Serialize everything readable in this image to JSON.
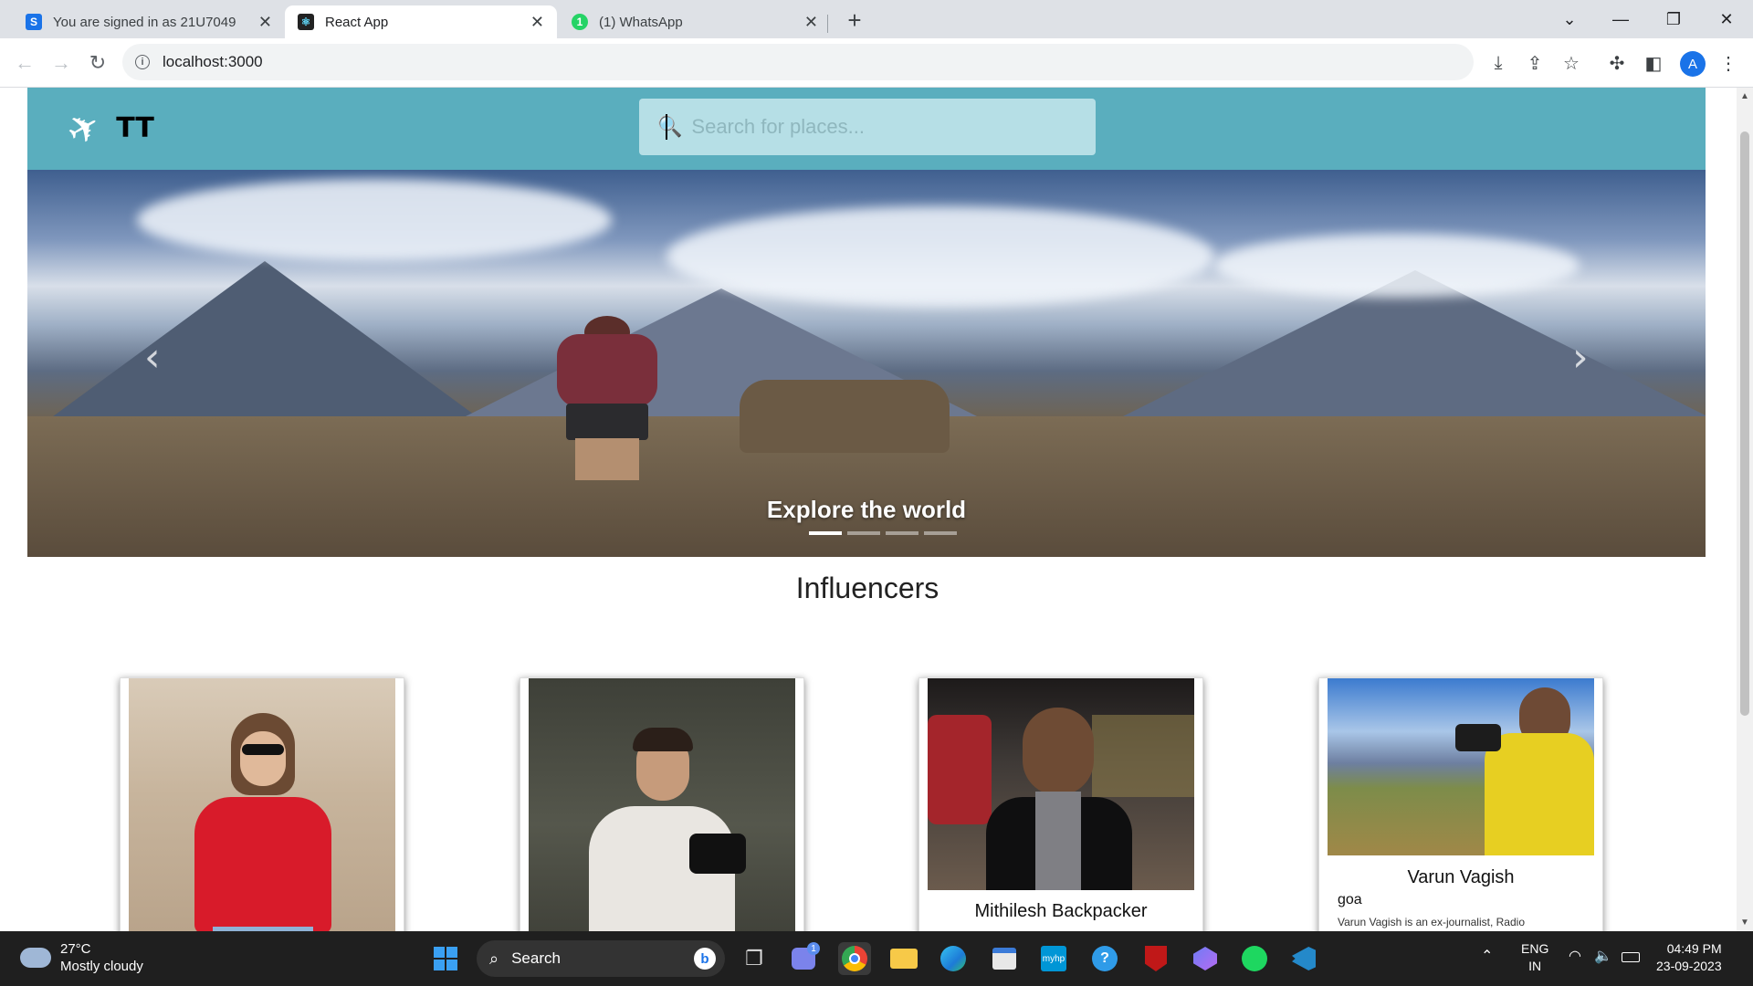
{
  "browser": {
    "tabs": [
      {
        "title": "You are signed in as 21U7049",
        "favicon": "S",
        "favicon_color": "#1a73e8",
        "active": false
      },
      {
        "title": "React App",
        "favicon": "react-icon",
        "favicon_color": "#222222",
        "active": true
      },
      {
        "title": "(1) WhatsApp",
        "favicon": "1",
        "favicon_color": "#25d366",
        "active": false
      }
    ],
    "url": "localhost:3000",
    "profile_initial": "A"
  },
  "site": {
    "brand": "TT",
    "search_placeholder": "Search for places...",
    "colors": {
      "navbar": "#5aaebe",
      "search_bg": "#b6dfe6"
    },
    "carousel": {
      "caption": "Explore the world",
      "prev_glyph": "‹",
      "next_glyph": "›",
      "slide_count": 4,
      "active_index": 0
    },
    "section_title": "Influencers",
    "influencers": [
      {
        "name": "",
        "location": "",
        "description": ""
      },
      {
        "name": "",
        "location": "",
        "description": ""
      },
      {
        "name": "Mithilesh Backpacker",
        "location": "",
        "description": ""
      },
      {
        "name": "Varun Vagish",
        "location": "goa",
        "description": "Varun Vagish is an ex-journalist, Radio"
      }
    ]
  },
  "taskbar": {
    "weather": {
      "temp": "27°C",
      "condition": "Mostly cloudy"
    },
    "search_label": "Search",
    "language": {
      "line1": "ENG",
      "line2": "IN"
    },
    "clock": {
      "time": "04:49 PM",
      "date": "23-09-2023"
    },
    "teams_badge": "1"
  }
}
